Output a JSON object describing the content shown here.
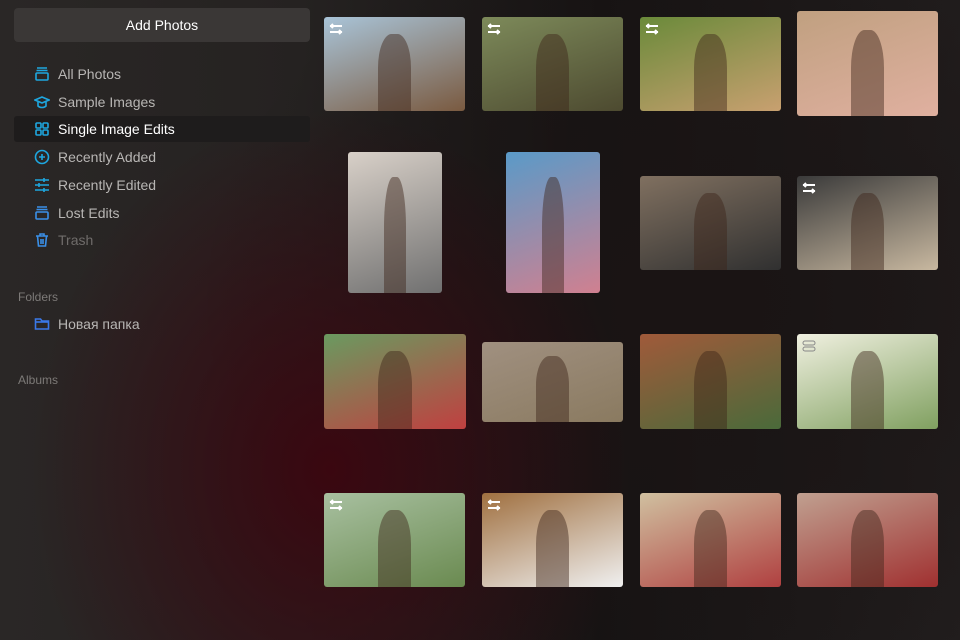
{
  "sidebar": {
    "add_button": "Add Photos",
    "items": [
      {
        "label": "All Photos",
        "icon": "stack-icon"
      },
      {
        "label": "Sample Images",
        "icon": "graduation-cap-icon"
      },
      {
        "label": "Single Image Edits",
        "icon": "grid-icon",
        "selected": true
      },
      {
        "label": "Recently Added",
        "icon": "plus-circle-icon"
      },
      {
        "label": "Recently Edited",
        "icon": "sliders-icon"
      },
      {
        "label": "Lost Edits",
        "icon": "stack-icon"
      },
      {
        "label": "Trash",
        "icon": "trash-icon"
      }
    ],
    "folders_heading": "Folders",
    "folders": [
      {
        "label": "Новая папка",
        "icon": "folder-icon"
      }
    ],
    "albums_heading": "Albums"
  },
  "colors": {
    "accent": "#1ea7e0",
    "selected_border": "#5fd0f0"
  }
}
